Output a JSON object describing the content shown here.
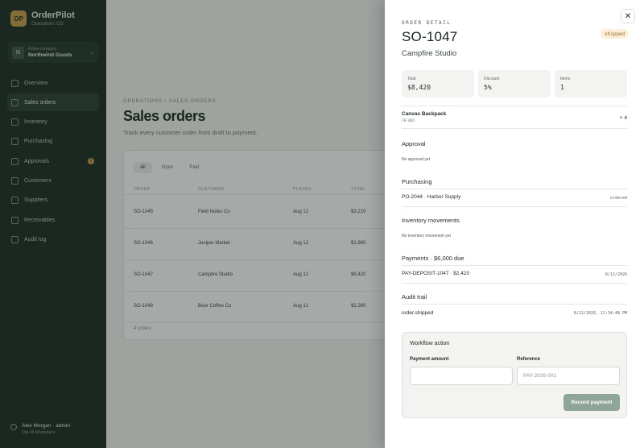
{
  "sidebar": {
    "brand_name": "OrderPilot",
    "brand_sub": "Operations OS",
    "brand_logo": "OP",
    "workspace_label": "Active company",
    "workspace_name": "Northwind Goods",
    "workspace_avatar": "N",
    "nav": [
      {
        "label": "Overview",
        "icon": "home-icon"
      },
      {
        "label": "Sales orders",
        "icon": "cart-icon",
        "active": true
      },
      {
        "label": "Inventory",
        "icon": "box-icon"
      },
      {
        "label": "Purchasing",
        "icon": "truck-icon"
      },
      {
        "label": "Approvals",
        "icon": "check-icon",
        "badge": "2"
      },
      {
        "label": "Customers",
        "icon": "users-icon"
      },
      {
        "label": "Suppliers",
        "icon": "building-icon"
      },
      {
        "label": "Receivables",
        "icon": "wallet-icon"
      },
      {
        "label": "Audit log",
        "icon": "list-icon"
      }
    ],
    "user_name": "Alex Morgan · admin",
    "user_sub": "Org 45 Workspace"
  },
  "main": {
    "breadcrumb": "OPERATIONS / SALES ORDERS",
    "title": "Sales orders",
    "subtitle": "Track every customer order from draft to payment.",
    "filters": [
      "All",
      "Open",
      "Paid"
    ],
    "columns": [
      "ORDER",
      "CUSTOMER",
      "PLACED",
      "TOTAL"
    ],
    "rows": [
      {
        "order": "SO-1045",
        "customer": "Field Notes Co",
        "placed": "Aug 12",
        "total": "$3,210"
      },
      {
        "order": "SO-1046",
        "customer": "Juniper Market",
        "placed": "Aug 12",
        "total": "$1,980"
      },
      {
        "order": "SO-1047",
        "customer": "Campfire Studio",
        "placed": "Aug 12",
        "total": "$8,420"
      },
      {
        "order": "SO-1048",
        "customer": "Bear Coffee Co",
        "placed": "Aug 12",
        "total": "$2,260"
      }
    ],
    "footer": "4 orders"
  },
  "drawer": {
    "eyebrow": "ORDER DETAIL",
    "order_number": "SO-1047",
    "status": "shipped",
    "customer": "Campfire Studio",
    "stats": [
      {
        "label": "Total",
        "value": "$8,420"
      },
      {
        "label": "Discount",
        "value": "5%"
      },
      {
        "label": "Items",
        "value": "1"
      }
    ],
    "line_item": {
      "name": "Canvas Backpack",
      "sku": "CB-001",
      "qty": "× 4"
    },
    "approval": {
      "title": "Approval",
      "text": "No approval yet"
    },
    "purchasing": {
      "title": "Purchasing",
      "po": "PO-2044 · Harbor Supply",
      "status": "ordered"
    },
    "inventory": {
      "title": "Inventory movements",
      "text": "No inventory movement yet"
    },
    "payments": {
      "title": "Payments · $6,000 due",
      "ref": "PAY-DEPOSIT-1047 · $2,420",
      "date": "8/12/2026"
    },
    "audit": {
      "title": "Audit trail",
      "event": "order.shipped",
      "timestamp": "8/12/2026, 12:34:48 PM"
    },
    "workflow": {
      "title": "Workflow action",
      "amount_label": "Payment amount",
      "amount_value": "",
      "reference_label": "Reference",
      "reference_placeholder": "PAY-2026-001",
      "button": "Record payment"
    }
  },
  "colors": {
    "sidebar_bg": "#1d2f26",
    "status_bg": "#fbeedb",
    "status_text": "#9a6a1f",
    "button_bg": "#8fa597"
  }
}
